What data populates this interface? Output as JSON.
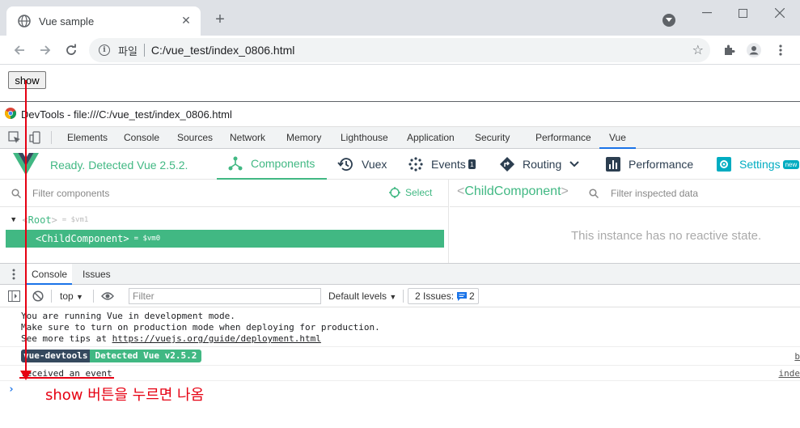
{
  "browser": {
    "tab_title": "Vue sample",
    "url_scheme_label": "파일",
    "url": "C:/vue_test/index_0806.html",
    "icons": [
      "globe-icon",
      "close-icon",
      "plus-icon",
      "minimize-icon",
      "maximize-icon",
      "window-close-icon",
      "back-icon",
      "forward-icon",
      "reload-icon",
      "info-icon",
      "star-icon",
      "extensions-icon",
      "profile-icon",
      "menu-icon"
    ]
  },
  "page": {
    "show_button": "show"
  },
  "devtools": {
    "title": "DevTools - file:///C:/vue_test/index_0806.html",
    "tabs": [
      "Elements",
      "Console",
      "Sources",
      "Network",
      "Memory",
      "Lighthouse",
      "Application",
      "Security",
      "Performance",
      "Vue"
    ],
    "active_tab": "Vue"
  },
  "vue": {
    "status": "Ready. Detected Vue 2.5.2.",
    "tabs": {
      "components": "Components",
      "vuex": "Vuex",
      "events": "Events",
      "events_badge": "1",
      "routing": "Routing",
      "performance": "Performance",
      "settings": "Settings",
      "settings_badge": "new"
    },
    "filter_placeholder": "Filter components",
    "select_label": "Select",
    "tree": {
      "root_name": "Root",
      "root_vm": "= $vm1",
      "child_name": "ChildComponent",
      "child_vm": "= $vm0"
    },
    "inspector": {
      "component_name": "ChildComponent",
      "filter_placeholder": "Filter inspected data",
      "empty_message": "This instance has no reactive state."
    }
  },
  "drawer": {
    "tabs": [
      "Console",
      "Issues"
    ],
    "active_tab": "Console"
  },
  "console": {
    "context": "top",
    "filter_placeholder": "Filter",
    "levels": "Default levels",
    "issues_label": "2 Issues:",
    "issues_count": "2",
    "messages": {
      "dev_mode_line1": "You are running Vue in development mode.",
      "dev_mode_line2": "Make sure to turn on production mode when deploying for production.",
      "dev_mode_line3_prefix": "See more tips at ",
      "dev_mode_link": "https://vuejs.org/guide/deployment.html",
      "devtools_badge": "vue-devtools",
      "devtools_detected": "Detected Vue v2.5.2",
      "devtools_src": "b",
      "event_msg": "received an event",
      "event_src": "inde"
    }
  },
  "annotation": {
    "text": "show 버튼을 누르면 나옴",
    "color": "#e60012"
  },
  "colors": {
    "vue_green": "#41b883",
    "vue_dark": "#35495e",
    "chrome_blue": "#1a73e8"
  }
}
